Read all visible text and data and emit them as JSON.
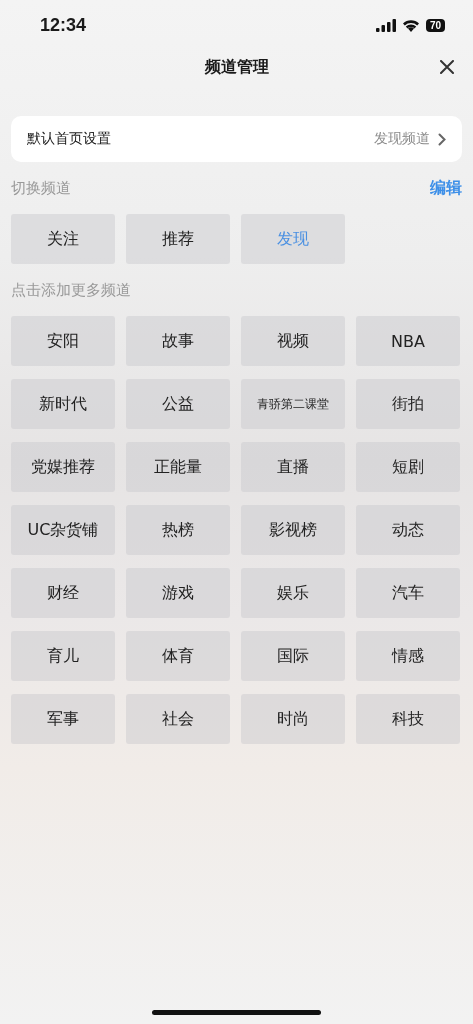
{
  "status_bar": {
    "time": "12:34",
    "battery": "70"
  },
  "header": {
    "title": "频道管理"
  },
  "default_home": {
    "label": "默认首页设置",
    "value": "发现频道"
  },
  "my_channels": {
    "title": "切换频道",
    "action": "编辑",
    "items": [
      {
        "label": "关注",
        "selected": false
      },
      {
        "label": "推荐",
        "selected": false
      },
      {
        "label": "发现",
        "selected": true
      }
    ]
  },
  "more_channels": {
    "title": "点击添加更多频道",
    "items": [
      "安阳",
      "故事",
      "视频",
      "NBA",
      "新时代",
      "公益",
      "青骄第二课堂",
      "街拍",
      "党媒推荐",
      "正能量",
      "直播",
      "短剧",
      "UC杂货铺",
      "热榜",
      "影视榜",
      "动态",
      "财经",
      "游戏",
      "娱乐",
      "汽车",
      "育儿",
      "体育",
      "国际",
      "情感",
      "军事",
      "社会",
      "时尚",
      "科技"
    ]
  }
}
